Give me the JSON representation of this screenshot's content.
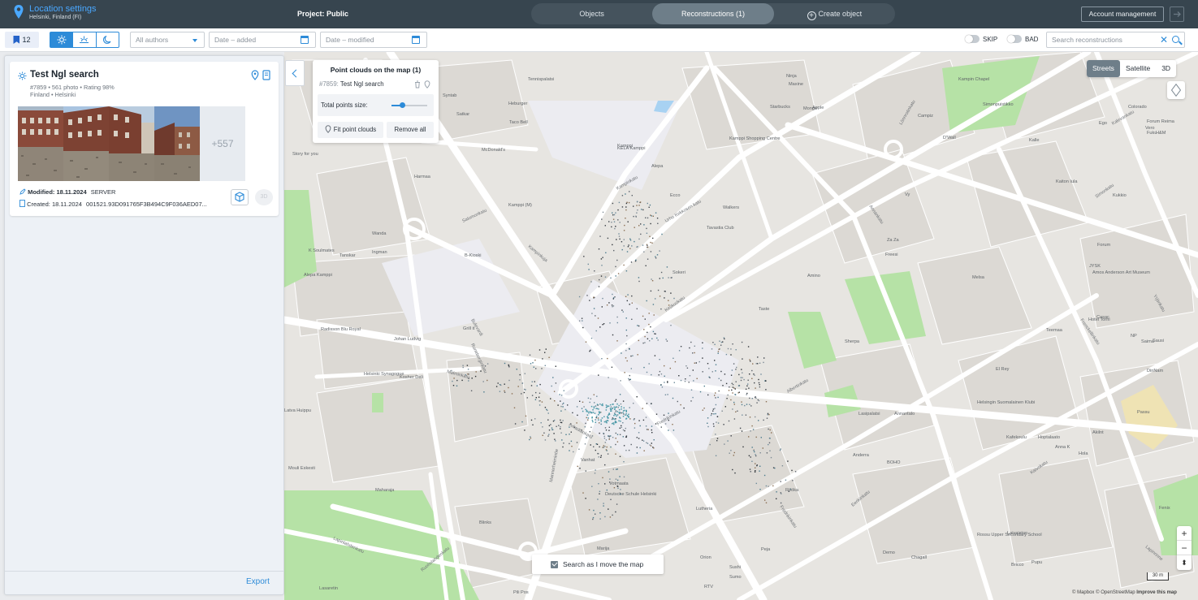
{
  "header": {
    "location_title": "Location settings",
    "location_sub": "Helsinki, Finland (FI)",
    "project": "Project: Public",
    "tabs": [
      {
        "label": "Objects",
        "active": false
      },
      {
        "label": "Reconstructions (1)",
        "active": true
      },
      {
        "label": "Create object",
        "active": false
      }
    ],
    "account_label": "Account management"
  },
  "filters": {
    "bookmark_count": "12",
    "authors_value": "All authors",
    "date_added_placeholder": "Date – added",
    "date_modified_placeholder": "Date – modified",
    "skip_label": "SKIP",
    "bad_label": "BAD",
    "search_placeholder": "Search reconstructions"
  },
  "reconstruction": {
    "title": "Test Ngl search",
    "meta_line1": "#7859 • 561 photo • Rating 98%",
    "meta_line2": "Finland • Helsinki",
    "more_photos": "+557",
    "modified_label": "Modified: 18.11.2024",
    "modified_source": "SERVER",
    "created_label": "Created: 18.11.2024",
    "created_id": "001521.93D091765F3B494C9F036AED07...",
    "btn_3d_text": "3D"
  },
  "panel": {
    "export_label": "Export"
  },
  "point_clouds": {
    "title": "Point clouds on the map (1)",
    "item_num": "#7859:",
    "item_name": "Test Ngl search",
    "size_label": "Total points size:",
    "size_value": 0.3,
    "fit_label": "Fit point clouds",
    "remove_label": "Remove all"
  },
  "map": {
    "styles": [
      {
        "label": "Streets",
        "active": true
      },
      {
        "label": "Satellite",
        "active": false
      },
      {
        "label": "3D",
        "active": false
      }
    ],
    "search_move_label": "Search as I move the map",
    "scale_label": "30 m",
    "attribution_mapbox": "© Mapbox",
    "attribution_osm": "© OpenStreetMap",
    "attribution_improve": "Improve this map",
    "street_labels": [
      "Mannerheimintie",
      "Simonkatu",
      "Kaivokatu",
      "Keskuskatu",
      "Eerikinkatu",
      "Annankatu",
      "Fredrikinkatu",
      "Kalevankatu",
      "Lönnrotinkatu",
      "Bulevardi",
      "Runeberginkatu",
      "Malminkatu",
      "Salomonkatu",
      "Kampinkuja",
      "Urho Kekkosen katu",
      "Kampinkatu",
      "Albertinkatu",
      "Yrjönkatu",
      "Lapinlahdenkatu",
      "Ruoholahdenkatu",
      "Lapinrinne",
      "Fredrikinkatu",
      "Arkadiankatu",
      "Frenckellinkatu"
    ],
    "poi_labels": [
      "Tennispalatsi",
      "Heburger",
      "Taco Bell",
      "Syntab",
      "Satkar",
      "McDonald's",
      "Story for you",
      "Harmaa",
      "KELA Kamppi",
      "Kamppi",
      "Alepa",
      "Ecco",
      "Walkers",
      "Tavastia Club",
      "Kamppi (M)",
      "B-Kioski",
      "Sokeri",
      "Wanda",
      "Ingman",
      "Tanskar",
      "K Soulmates",
      "Alepa Kamppi",
      "Radisson Blu Royal",
      "Grill it",
      "Johan Ludvig",
      "Helsinki Synagogue",
      "Kosher Deli",
      "Latva Huippu",
      "Mouli Eskesti",
      "Maharaja",
      "Blinks",
      "Marija",
      "Vanhat",
      "Votmaata",
      "Deutsche Schule Helsinki",
      "Lutheria",
      "Sushi",
      "Orion",
      "Rööka",
      "Anderra",
      "BOHO",
      "Chagall",
      "Demo",
      "Peja",
      "Sumo",
      "RTV",
      "Lasaretin",
      "Pili Pos",
      "Kampin Chapel",
      "Simonpuistikko",
      "Starbucks",
      "Apple",
      "Kamppi Shopping Centre",
      "Ninja",
      "Maxine",
      "Mongo",
      "Campiz",
      "D'Wall",
      "Colorado",
      "Forum Reima",
      "Ego",
      "Vero",
      "H&M",
      "Fuku",
      "Kalle",
      "Kaiton Iula",
      "Kukkio",
      "Forum",
      "JYSK",
      "Amos Anderson Art Museum",
      "Melsa",
      "Vy",
      "Za Za",
      "Freesi",
      "Amino",
      "Taste",
      "Sherpa",
      "Lasipalatsi",
      "Annantalo",
      "Helsingin Suomalainen Klubi",
      "Kafekoulu",
      "Hoptalaato",
      "Hola",
      "Anna K",
      "Akilnt",
      "Passu",
      "Fenix",
      "Rossu Upper Secondary School",
      "Laivaiston",
      "Bricco",
      "Pupu",
      "El Rey",
      "Teemaa",
      "DinNam",
      "Sausi",
      "Saima",
      "Hotel Torni",
      "Casac",
      "NP"
    ]
  }
}
